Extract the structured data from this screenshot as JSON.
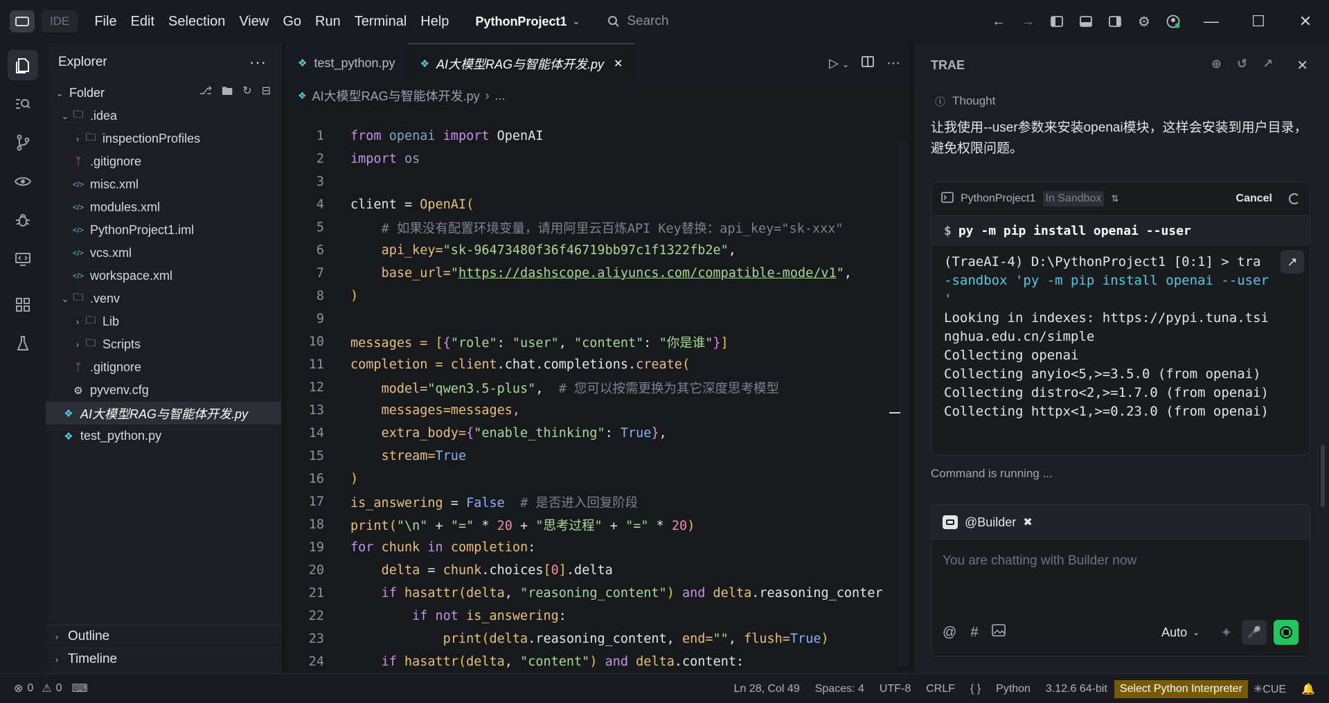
{
  "titlebar": {
    "ide_badge": "IDE",
    "menu": [
      "File",
      "Edit",
      "Selection",
      "View",
      "Go",
      "Run",
      "Terminal",
      "Help"
    ],
    "project": "PythonProject1",
    "search_placeholder": "Search"
  },
  "explorer": {
    "title": "Explorer",
    "root": "Folder",
    "items": [
      {
        "label": ".idea",
        "icon": "folder-icon",
        "depth": 0,
        "chevron": "down"
      },
      {
        "label": "inspectionProfiles",
        "icon": "folder-icon",
        "depth": 1,
        "chevron": "right"
      },
      {
        "label": ".gitignore",
        "icon": "git-icon",
        "depth": 1,
        "chevron": ""
      },
      {
        "label": "misc.xml",
        "icon": "xml-icon",
        "depth": 1,
        "chevron": ""
      },
      {
        "label": "modules.xml",
        "icon": "xml-icon",
        "depth": 1,
        "chevron": ""
      },
      {
        "label": "PythonProject1.iml",
        "icon": "xml-icon",
        "depth": 1,
        "chevron": ""
      },
      {
        "label": "vcs.xml",
        "icon": "xml-icon",
        "depth": 1,
        "chevron": ""
      },
      {
        "label": "workspace.xml",
        "icon": "xml-icon",
        "depth": 1,
        "chevron": ""
      },
      {
        "label": ".venv",
        "icon": "folder-icon",
        "depth": 0,
        "chevron": "down"
      },
      {
        "label": "Lib",
        "icon": "folder-icon",
        "depth": 1,
        "chevron": "right"
      },
      {
        "label": "Scripts",
        "icon": "folder-icon",
        "depth": 1,
        "chevron": "right"
      },
      {
        "label": ".gitignore",
        "icon": "git-icon",
        "depth": 1,
        "chevron": ""
      },
      {
        "label": "pyvenv.cfg",
        "icon": "gear-icon",
        "depth": 1,
        "chevron": ""
      },
      {
        "label": "AI大模型RAG与智能体开发.py",
        "icon": "python-icon",
        "depth": 0,
        "chevron": "",
        "selected": true
      },
      {
        "label": "test_python.py",
        "icon": "python-icon",
        "depth": 0,
        "chevron": ""
      }
    ],
    "outline": "Outline",
    "timeline": "Timeline"
  },
  "editor": {
    "tabs": [
      {
        "label": "test_python.py",
        "active": false
      },
      {
        "label": "AI大模型RAG与智能体开发.py",
        "active": true
      }
    ],
    "breadcrumb": [
      "AI大模型RAG与智能体开发.py",
      "..."
    ],
    "line_numbers": [
      "1",
      "2",
      "3",
      "4",
      "5",
      "6",
      "7",
      "8",
      "9",
      "10",
      "11",
      "12",
      "13",
      "14",
      "15",
      "16",
      "17",
      "18",
      "19",
      "20",
      "21",
      "22",
      "23",
      "24"
    ],
    "code": {
      "l1_a": "from",
      "l1_b": "openai",
      "l1_c": "import",
      "l1_d": "OpenAI",
      "l2_a": "import",
      "l2_b": "os",
      "l4_a": "client = ",
      "l4_b": "OpenAI",
      "l5": "# 如果没有配置环境变量，请用阿里云百炼API Key替换：api_key=\"sk-xxx\"",
      "l6_a": "api_key=",
      "l6_b": "\"sk-96473480f36f46719bb97c1f1322fb2e\"",
      "l7_a": "base_url=",
      "l7_b": "\"",
      "l7_c": "https://dashscope.aliyuncs.com/compatible-mode/v1",
      "l7_d": "\"",
      "l10_a": "messages = ",
      "l10_b": "\"role\"",
      "l10_c": "\"user\"",
      "l10_d": "\"content\"",
      "l10_e": "\"你是谁\"",
      "l11_a": "completion = ",
      "l11_b": "client",
      "l11_c": ".chat.completions.",
      "l11_d": "create",
      "l12_a": "model=",
      "l12_b": "\"qwen3.5-plus\"",
      "l12_c": "# 您可以按需更换为其它深度思考模型",
      "l13": "messages=messages,",
      "l14_a": "extra_body=",
      "l14_b": "\"enable_thinking\"",
      "l14_c": "True",
      "l15_a": "stream=",
      "l15_b": "True",
      "l17_a": "is_answering",
      "l17_b": " = ",
      "l17_c": "False",
      "l17_d": "# 是否进入回复阶段",
      "l18_a": "print",
      "l18_b": "\"\\n\"",
      "l18_c": "\"=\"",
      "l18_d": "20",
      "l18_e": "\"思考过程\"",
      "l18_f": "\"=\"",
      "l18_g": "20",
      "l19_a": "for",
      "l19_b": "chunk",
      "l19_c": "in",
      "l19_d": "completion",
      "l20_a": "delta",
      "l20_b": " = ",
      "l20_c": "chunk",
      "l20_d": ".choices",
      "l20_e": "0",
      "l20_f": ".delta",
      "l21_a": "if",
      "l21_b": "hasattr",
      "l21_c": "delta",
      "l21_d": "\"reasoning_content\"",
      "l21_e": "and",
      "l21_f": "delta",
      "l21_g": ".reasoning_conter",
      "l22_a": "if",
      "l22_b": "not",
      "l22_c": "is_answering",
      "l23_a": "print",
      "l23_b": "delta",
      "l23_c": ".reasoning_content, ",
      "l23_d": "end=",
      "l23_e": "\"\"",
      "l23_f": "flush=",
      "l23_g": "True",
      "l24_a": "if",
      "l24_b": "hasattr",
      "l24_c": "delta",
      "l24_d": "\"content\"",
      "l24_e": "and",
      "l24_f": "delta",
      "l24_g": ".content:"
    }
  },
  "chat": {
    "title": "TRAE",
    "thought": "Thought",
    "message": "让我使用--user参数来安装openai模块，这样会安装到用户目录，避免权限问题。",
    "terminal": {
      "project": "PythonProject1",
      "sandbox": "In Sandbox",
      "cancel": "Cancel",
      "command": "py -m pip install openai --user",
      "out1": "(TraeAI-4) D:\\PythonProject1 [0:1] > tra",
      "out2a": "-sandbox ",
      "out2b": "'py -m pip install openai --user",
      "out3": "'",
      "out4": "Looking in indexes: https://pypi.tuna.tsi",
      "out5": "nghua.edu.cn/simple",
      "out6": "Collecting openai",
      "out7": "Collecting anyio<5,>=3.5.0 (from openai)",
      "out8": "Collecting distro<2,>=1.7.0 (from openai)",
      "out9": "Collecting httpx<1,>=0.23.0 (from openai)"
    },
    "running": "Command is running ...",
    "builder": "@Builder",
    "placeholder": "You are chatting with Builder now",
    "mode": "Auto"
  },
  "statusbar": {
    "errors": "0",
    "warnings": "0",
    "position": "Ln 28, Col 49",
    "spaces": "Spaces: 4",
    "encoding": "UTF-8",
    "eol": "CRLF",
    "braces": "{ }",
    "language": "Python",
    "version": "3.12.6 64-bit",
    "interpreter": "Select Python Interpreter",
    "cue": "CUE"
  },
  "colors": {
    "accent_green": "#22c55e",
    "interpreter_bg": "#7a5a00"
  }
}
